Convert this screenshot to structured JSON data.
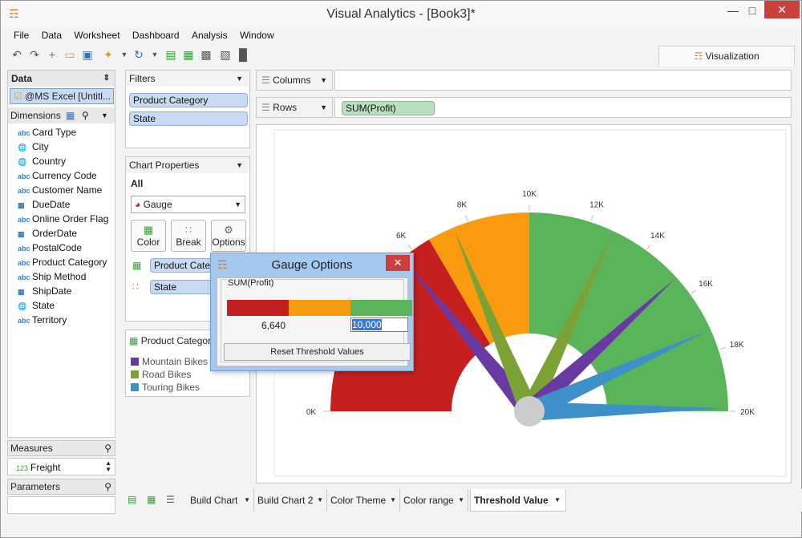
{
  "window": {
    "title": "Visual Analytics - [Book3]*",
    "controls": [
      "—",
      "□",
      "✕"
    ]
  },
  "menu": [
    "File",
    "Data",
    "Worksheet",
    "Dashboard",
    "Analysis",
    "Window"
  ],
  "visualization_tab": "Visualization",
  "data_panel": {
    "header": "Data",
    "source": "@MS Excel [Untitl...",
    "dimensions_header": "Dimensions",
    "dimensions": [
      {
        "icon": "abc",
        "label": "Card Type"
      },
      {
        "icon": "globe",
        "label": "City"
      },
      {
        "icon": "globe",
        "label": "Country"
      },
      {
        "icon": "abc",
        "label": "Currency Code"
      },
      {
        "icon": "abc",
        "label": "Customer Name"
      },
      {
        "icon": "calendar",
        "label": "DueDate"
      },
      {
        "icon": "abc",
        "label": "Online Order Flag"
      },
      {
        "icon": "calendar",
        "label": "OrderDate"
      },
      {
        "icon": "abc",
        "label": "PostalCode"
      },
      {
        "icon": "abc",
        "label": "Product Category"
      },
      {
        "icon": "abc",
        "label": "Ship Method"
      },
      {
        "icon": "calendar",
        "label": "ShipDate"
      },
      {
        "icon": "globe",
        "label": "State"
      },
      {
        "icon": "abc",
        "label": "Territory"
      }
    ],
    "measures_header": "Measures",
    "measures": [
      {
        "icon": "123",
        "label": "Freight"
      }
    ],
    "parameters_header": "Parameters"
  },
  "filters": {
    "header": "Filters",
    "items": [
      "Product Category",
      "State"
    ]
  },
  "chart_properties": {
    "header": "Chart Properties",
    "scope": "All",
    "chart_type": "Gauge",
    "buttons": [
      {
        "label": "Color",
        "icon": "color-icon"
      },
      {
        "label": "Break",
        "icon": "break-icon"
      },
      {
        "label": "Options",
        "icon": "gear-icon"
      }
    ],
    "marks": [
      "Product Category",
      "State"
    ]
  },
  "legend": {
    "title": "Product Category",
    "items": [
      {
        "label": "Mountain Bikes",
        "color": "#6a3aa3"
      },
      {
        "label": "Road Bikes",
        "color": "#7ca236"
      },
      {
        "label": "Touring Bikes",
        "color": "#3d90c8"
      }
    ]
  },
  "shelves": {
    "columns_label": "Columns",
    "rows_label": "Rows",
    "rows_pill": "SUM(Profit)"
  },
  "dialog": {
    "title": "Gauge Options",
    "group": "SUM(Profit)",
    "threshold_1": "6,640",
    "threshold_2": "10,000",
    "reset_label": "Reset Threshold Values",
    "colors": [
      "#c51f1f",
      "#f99a0f",
      "#5ab45a"
    ]
  },
  "bottom_tabs": [
    "Build Chart",
    "Build Chart 2",
    "Color Theme",
    "Color range",
    "Threshold Value"
  ],
  "active_tab": "Threshold Value",
  "chart_data": {
    "type": "gauge",
    "axis": {
      "min": 0,
      "max": 20000,
      "ticks": [
        0,
        6000,
        8000,
        10000,
        12000,
        14000,
        16000,
        18000,
        20000
      ],
      "tick_labels": [
        "0K",
        "6K",
        "8K",
        "10K",
        "12K",
        "14K",
        "16K",
        "18K",
        "20K"
      ]
    },
    "bands": [
      {
        "from": 0,
        "to": 6640,
        "color": "#c51f1f"
      },
      {
        "from": 6640,
        "to": 10000,
        "color": "#f99a0f"
      },
      {
        "from": 10000,
        "to": 20000,
        "color": "#5ab45a"
      }
    ],
    "needles": [
      {
        "series": "Mountain Bikes",
        "value": 5600,
        "color": "#6a3aa3"
      },
      {
        "series": "Road Bikes",
        "value": 7500,
        "color": "#7ca236"
      },
      {
        "series": "Road Bikes",
        "value": 12800,
        "color": "#7ca236"
      },
      {
        "series": "Mountain Bikes",
        "value": 15300,
        "color": "#6a3aa3"
      },
      {
        "series": "Touring Bikes",
        "value": 17300,
        "color": "#3d90c8"
      },
      {
        "series": "Touring Bikes",
        "value": 19900,
        "color": "#3d90c8"
      }
    ]
  }
}
